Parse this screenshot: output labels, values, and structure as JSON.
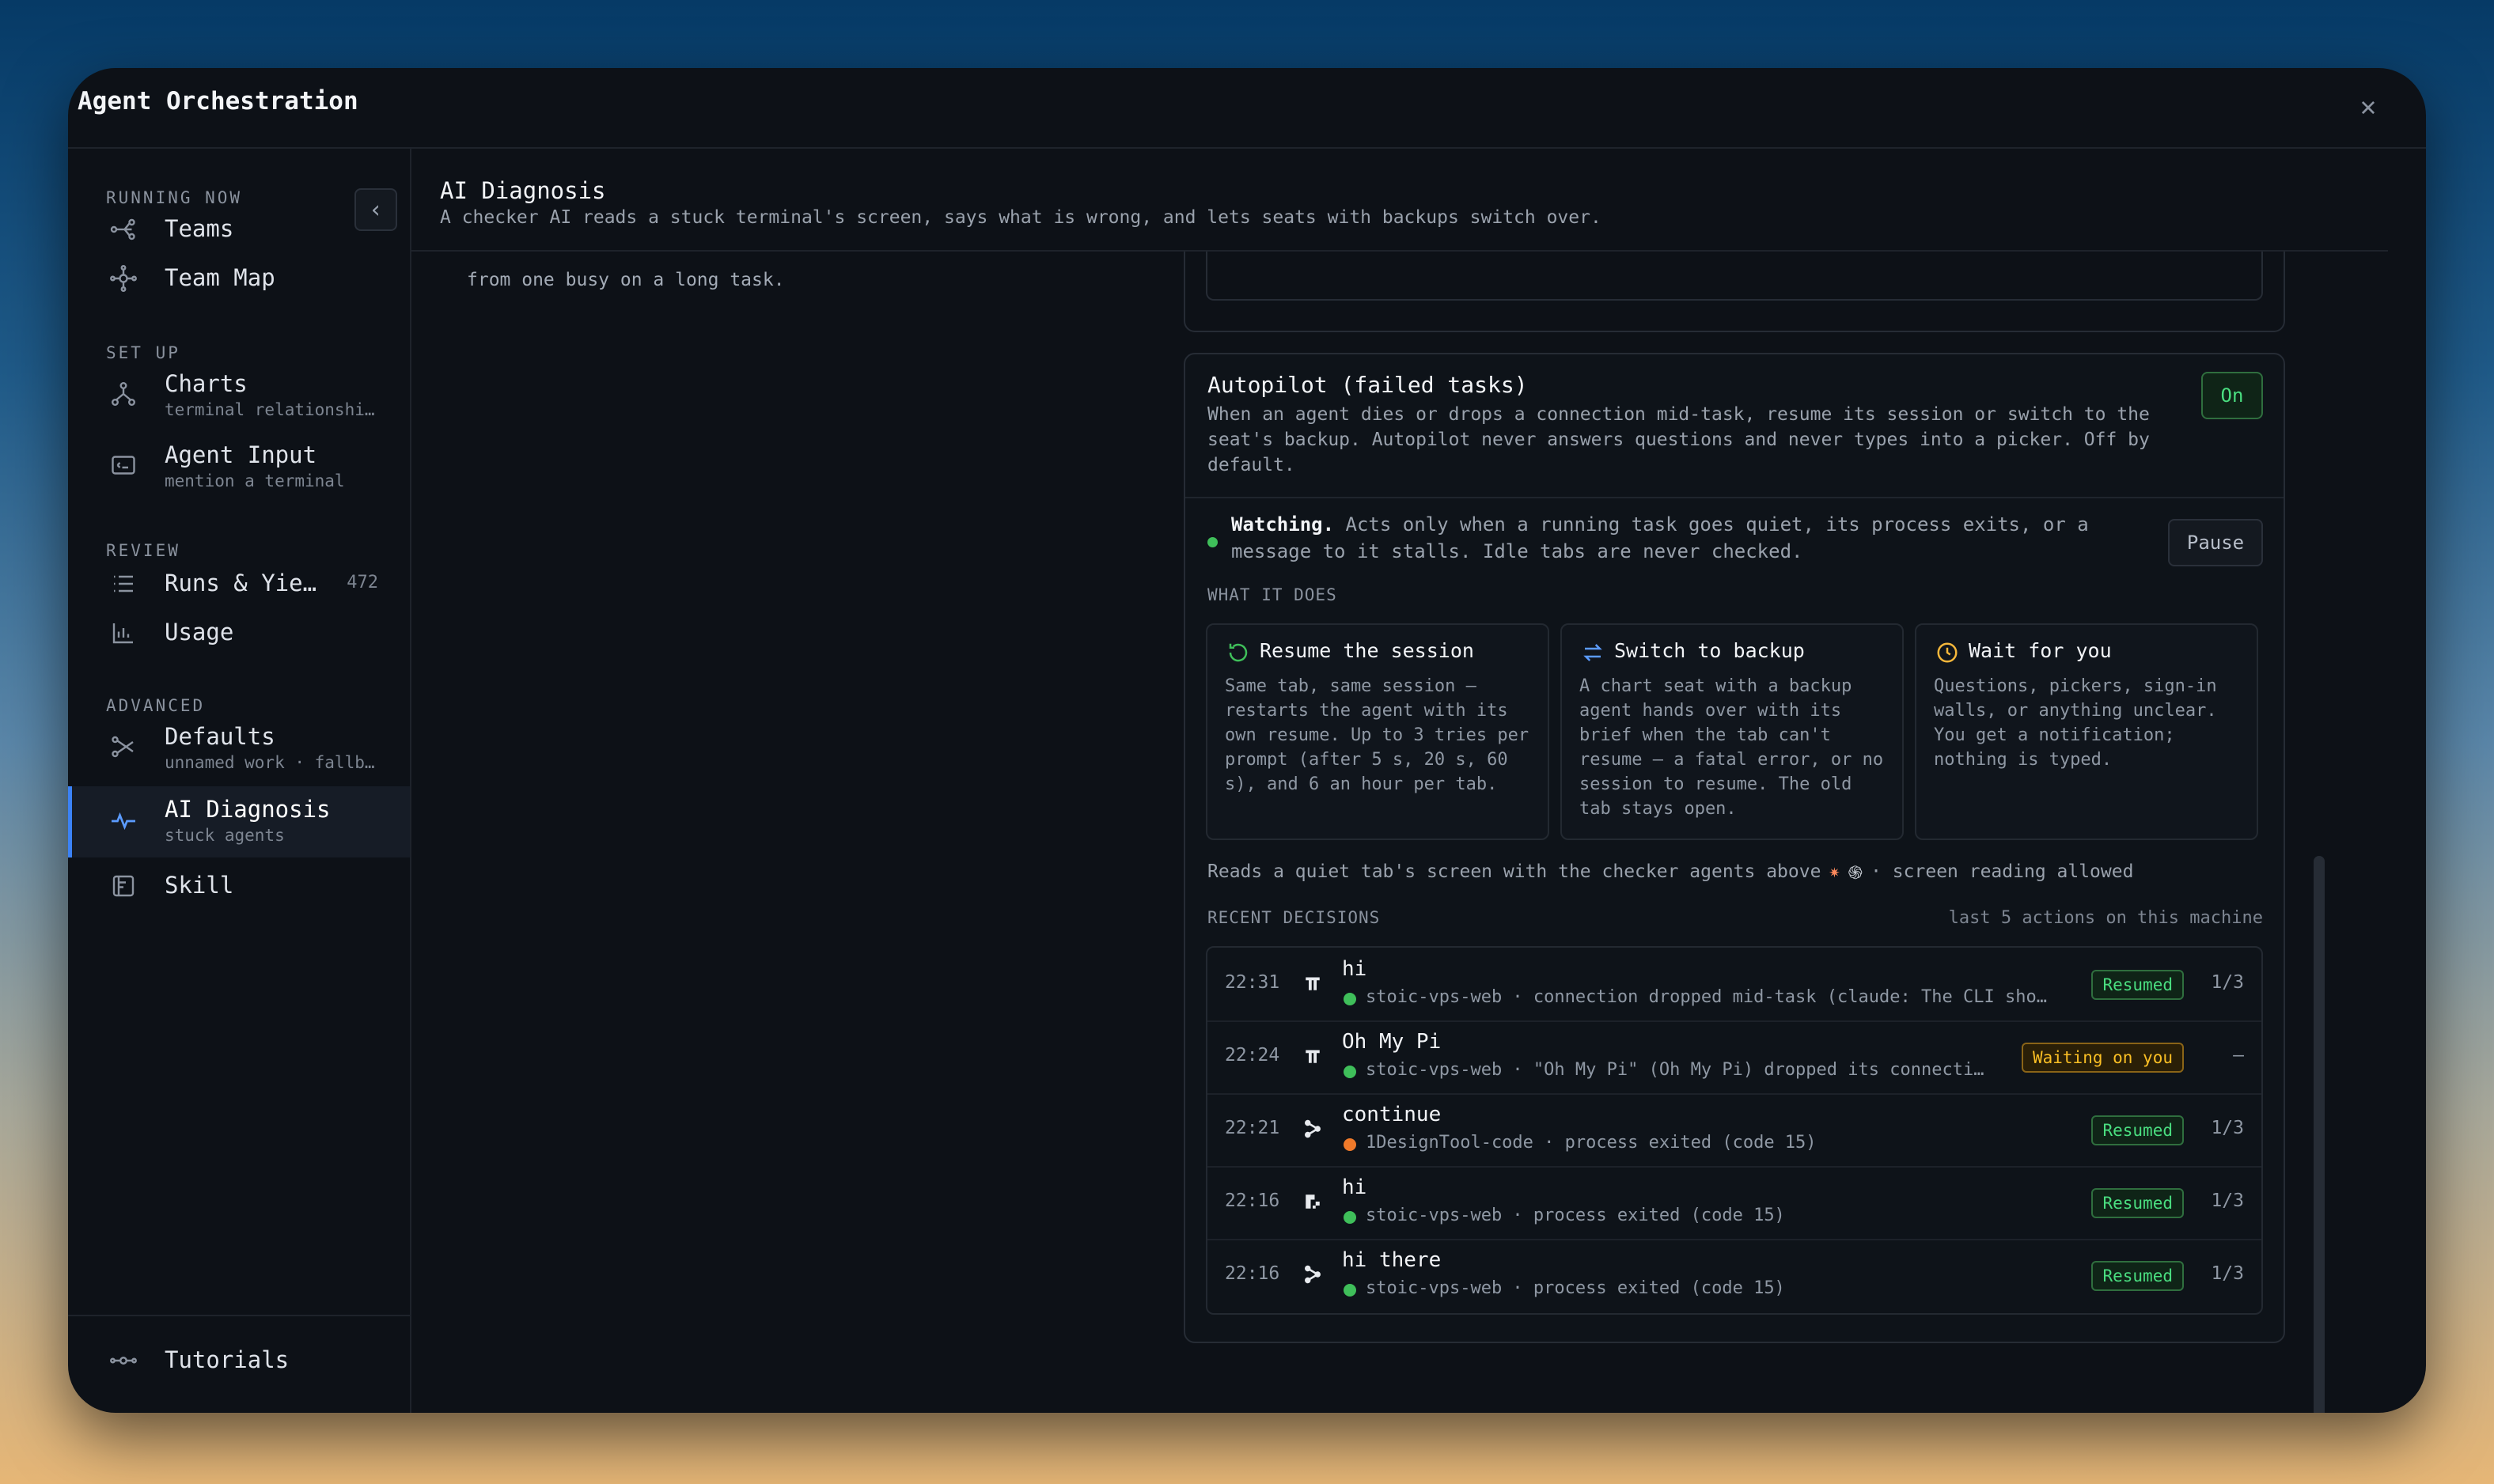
{
  "window": {
    "title": "Agent Orchestration"
  },
  "sidebar": {
    "sections": {
      "running_now": "RUNNING NOW",
      "set_up": "SET UP",
      "review": "REVIEW",
      "advanced": "ADVANCED"
    },
    "items": [
      {
        "label": "Teams",
        "icon": "teams-icon"
      },
      {
        "label": "Team Map",
        "icon": "team-map-icon"
      },
      {
        "label": "Charts",
        "sub": "terminal relationshi…",
        "icon": "charts-icon"
      },
      {
        "label": "Agent Input",
        "sub": "mention a terminal",
        "icon": "agent-input-icon"
      },
      {
        "label": "Runs & Yie…",
        "count": "472",
        "icon": "list-icon"
      },
      {
        "label": "Usage",
        "icon": "bar-chart-icon"
      },
      {
        "label": "Defaults",
        "sub": "unnamed work · fallb…",
        "icon": "branch-icon"
      },
      {
        "label": "AI Diagnosis",
        "sub": "stuck agents",
        "icon": "pulse-icon",
        "active": true
      },
      {
        "label": "Skill",
        "icon": "book-icon"
      }
    ],
    "footer": {
      "label": "Tutorials",
      "icon": "tutorials-icon"
    }
  },
  "main": {
    "title": "AI Diagnosis",
    "subtitle": "A checker AI reads a stuck terminal's screen, says what is wrong, and lets seats with backups switch over.",
    "prev_card_text": "from one busy on a long task.",
    "autopilot": {
      "title": "Autopilot (failed tasks)",
      "description": "When an agent dies or drops a connection mid-task, resume its session or switch to the seat's backup. Autopilot never answers questions and never types into a picker. Off by default.",
      "toggle": "On",
      "watching_bold": "Watching.",
      "watching_text": " Acts only when a running task goes quiet, its process exits, or a message to it stalls. Idle tabs are never checked.",
      "pause": "Pause",
      "what_it_does": "WHAT IT DOES",
      "features": [
        {
          "title": "Resume the session",
          "desc": "Same tab, same session — restarts the agent with its own resume. Up to 3 tries per prompt (after 5 s, 20 s, 60 s), and 6 an hour per tab.",
          "icon": "refresh-icon",
          "color": "#3fbf5a"
        },
        {
          "title": "Switch to backup",
          "desc": "A chart seat with a backup agent hands over with its brief when the tab can't resume — a fatal error, or no session to resume. The old tab stays open.",
          "icon": "swap-icon",
          "color": "#5b9bff"
        },
        {
          "title": "Wait for you",
          "desc": "Questions, pickers, sign-in walls, or anything unclear. You get a notification; nothing is typed.",
          "icon": "clock-icon",
          "color": "#f5b73b"
        }
      ],
      "reads_text": "Reads a quiet tab's screen with the checker agents above",
      "reads_suffix": "· screen reading allowed",
      "recent_label": "RECENT DECISIONS",
      "recent_right": "last 5 actions on this machine",
      "decisions": [
        {
          "time": "22:31",
          "title": "hi",
          "dot": "#3fbf5a",
          "detail": "stoic-vps-web · connection dropped mid-task (claude: The CLI show…",
          "badge": "Resumed",
          "kind": "ok",
          "frac": "1/3",
          "icon": "pi-icon"
        },
        {
          "time": "22:24",
          "title": "Oh My Pi",
          "dot": "#3fbf5a",
          "detail": "stoic-vps-web · \"Oh My Pi\" (Oh My Pi) dropped its connecti…",
          "badge": "Waiting on you",
          "kind": "wait",
          "frac": "—",
          "icon": "pi-icon"
        },
        {
          "time": "22:21",
          "title": "continue",
          "dot": "#f07a2a",
          "detail": "1DesignTool-code · process exited (code 15)",
          "badge": "Resumed",
          "kind": "ok",
          "frac": "1/3",
          "icon": "hub-icon"
        },
        {
          "time": "22:16",
          "title": "hi",
          "dot": "#3fbf5a",
          "detail": "stoic-vps-web · process exited (code 15)",
          "badge": "Resumed",
          "kind": "ok",
          "frac": "1/3",
          "icon": "blocks-icon"
        },
        {
          "time": "22:16",
          "title": "hi there",
          "dot": "#3fbf5a",
          "detail": "stoic-vps-web · process exited (code 15)",
          "badge": "Resumed",
          "kind": "ok",
          "frac": "1/3",
          "icon": "hub-icon"
        }
      ]
    }
  }
}
